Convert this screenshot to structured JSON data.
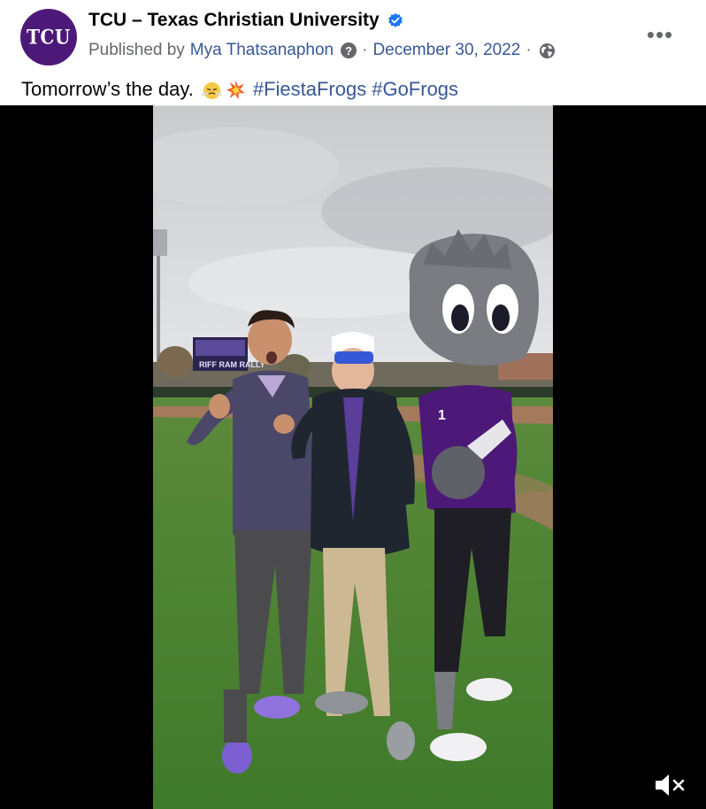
{
  "post": {
    "page_name": "TCU – Texas Christian University",
    "avatar_text": "TCU",
    "published_prefix": "Published by",
    "publisher": "Mya Thatsanaphon",
    "separator": "·",
    "date": "December 30, 2022",
    "privacy_icon": "globe-icon",
    "verified_icon": "verified-badge-icon",
    "more_icon": "more-options-icon",
    "more_label": "•••"
  },
  "caption": {
    "text": "Tomorrow’s the day.",
    "emojis": [
      "steaming-face-emoji",
      "collision-emoji"
    ],
    "hashtags": [
      "#FiestaFrogs",
      "#GoFrogs"
    ]
  },
  "video": {
    "scoreboard_text": "RIFF RAM RALLY",
    "mascot_jersey_number": "1",
    "mute_icon": "speaker-muted-icon"
  },
  "colors": {
    "tcu_purple": "#4d1979",
    "link_blue": "#385898",
    "verified_blue": "#1877f2",
    "meta_gray": "#65676b"
  }
}
